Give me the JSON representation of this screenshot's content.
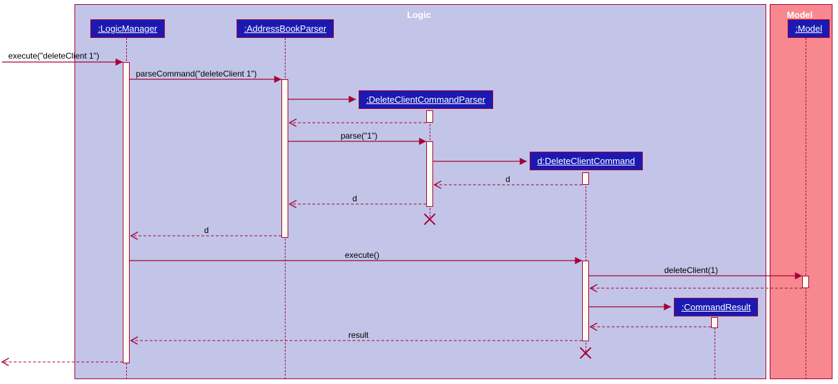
{
  "frames": {
    "logic": "Logic",
    "model": "Model"
  },
  "participants": {
    "logicManager": ":LogicManager",
    "addressBookParser": ":AddressBookParser",
    "deleteClientCommandParser": ":DeleteClientCommandParser",
    "deleteClientCommand": "d:DeleteClientCommand",
    "commandResult": ":CommandResult",
    "model": ":Model"
  },
  "messages": {
    "execute_in": "execute(\"deleteClient 1\")",
    "parseCommand": "parseCommand(\"deleteClient 1\")",
    "parse": "parse(\"1\")",
    "d_ret1": "d",
    "d_ret2": "d",
    "d_ret3": "d",
    "execute": "execute()",
    "deleteClient": "deleteClient(1)",
    "result": "result"
  },
  "chart_data": {
    "type": "sequence-diagram",
    "frames": [
      {
        "name": "Logic",
        "participants": [
          "LogicManager",
          "AddressBookParser",
          "DeleteClientCommandParser",
          "DeleteClientCommand",
          "CommandResult"
        ]
      },
      {
        "name": "Model",
        "participants": [
          "Model"
        ]
      }
    ],
    "participants": [
      {
        "id": "LogicManager",
        "label": ":LogicManager"
      },
      {
        "id": "AddressBookParser",
        "label": ":AddressBookParser"
      },
      {
        "id": "DeleteClientCommandParser",
        "label": ":DeleteClientCommandParser",
        "created_by_msg": 2,
        "destroyed_after_msg": 7
      },
      {
        "id": "DeleteClientCommand",
        "label": "d:DeleteClientCommand",
        "created_by_msg": 4,
        "destroyed_after_msg": 12
      },
      {
        "id": "CommandResult",
        "label": ":CommandResult",
        "created_by_msg": 10
      },
      {
        "id": "Model",
        "label": ":Model"
      }
    ],
    "messages": [
      {
        "n": 1,
        "from": null,
        "to": "LogicManager",
        "label": "execute(\"deleteClient 1\")",
        "type": "sync"
      },
      {
        "n": 2,
        "from": "LogicManager",
        "to": "AddressBookParser",
        "label": "parseCommand(\"deleteClient 1\")",
        "type": "sync"
      },
      {
        "n": 3,
        "from": "AddressBookParser",
        "to": "DeleteClientCommandParser",
        "label": "",
        "type": "create"
      },
      {
        "n": 4,
        "from": "DeleteClientCommandParser",
        "to": "AddressBookParser",
        "label": "",
        "type": "return"
      },
      {
        "n": 5,
        "from": "AddressBookParser",
        "to": "DeleteClientCommandParser",
        "label": "parse(\"1\")",
        "type": "sync"
      },
      {
        "n": 6,
        "from": "DeleteClientCommandParser",
        "to": "DeleteClientCommand",
        "label": "",
        "type": "create"
      },
      {
        "n": 7,
        "from": "DeleteClientCommand",
        "to": "DeleteClientCommandParser",
        "label": "d",
        "type": "return"
      },
      {
        "n": 8,
        "from": "DeleteClientCommandParser",
        "to": "AddressBookParser",
        "label": "d",
        "type": "return"
      },
      {
        "n": 9,
        "from": "AddressBookParser",
        "to": "LogicManager",
        "label": "d",
        "type": "return"
      },
      {
        "n": 10,
        "from": "LogicManager",
        "to": "DeleteClientCommand",
        "label": "execute()",
        "type": "sync"
      },
      {
        "n": 11,
        "from": "DeleteClientCommand",
        "to": "Model",
        "label": "deleteClient(1)",
        "type": "sync"
      },
      {
        "n": 12,
        "from": "Model",
        "to": "DeleteClientCommand",
        "label": "",
        "type": "return"
      },
      {
        "n": 13,
        "from": "DeleteClientCommand",
        "to": "CommandResult",
        "label": "",
        "type": "create"
      },
      {
        "n": 14,
        "from": "CommandResult",
        "to": "DeleteClientCommand",
        "label": "",
        "type": "return"
      },
      {
        "n": 15,
        "from": "DeleteClientCommand",
        "to": "LogicManager",
        "label": "result",
        "type": "return"
      },
      {
        "n": 16,
        "from": "LogicManager",
        "to": null,
        "label": "",
        "type": "return"
      }
    ]
  }
}
